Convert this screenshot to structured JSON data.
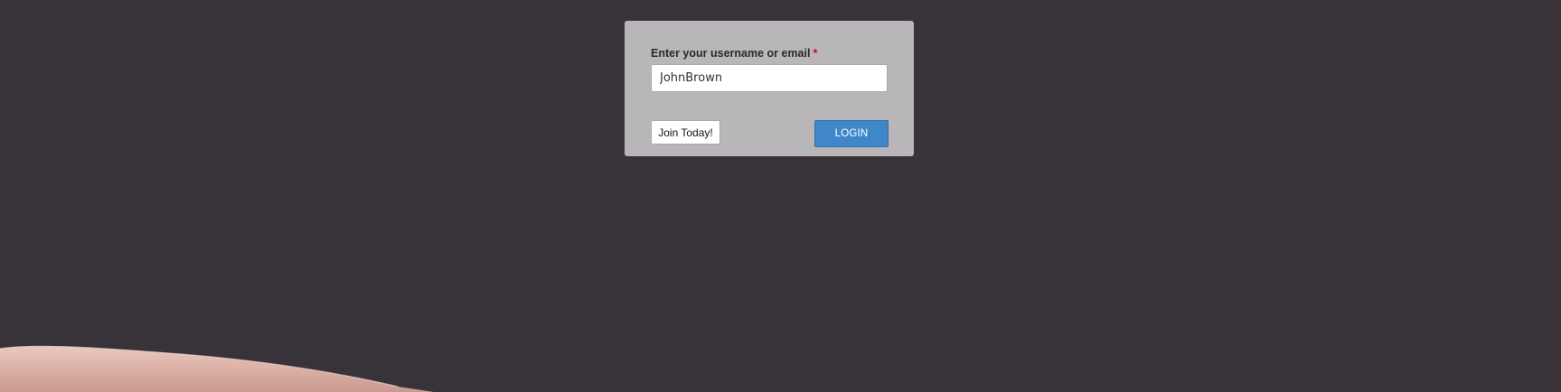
{
  "login_form": {
    "username_label": "Enter your username or email",
    "required_marker": "*",
    "username_value": "JohnBrown",
    "join_button_label": "Join Today!",
    "login_button_label": "LOGIN"
  },
  "colors": {
    "page_background": "#373338",
    "card_background": "#b8b6b9",
    "login_button": "#3f87c9",
    "required_marker": "#d0021b"
  }
}
